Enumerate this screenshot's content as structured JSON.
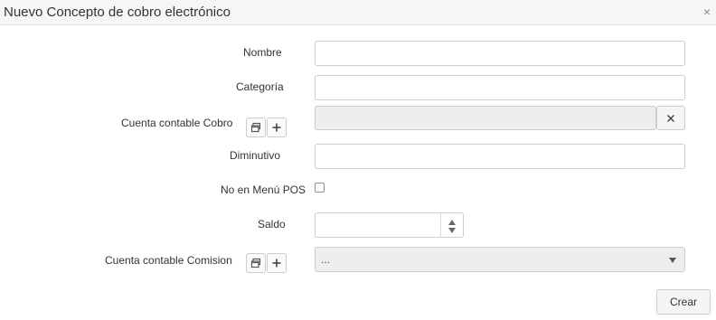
{
  "dialog": {
    "title": "Nuevo Concepto de cobro electrónico",
    "close_glyph": "×"
  },
  "fields": {
    "nombre": {
      "label": "Nombre",
      "value": ""
    },
    "categoria": {
      "label": "Categoría",
      "value": ""
    },
    "cuenta_cobro": {
      "label": "Cuenta contable Cobro",
      "value": ""
    },
    "diminutivo": {
      "label": "Diminutivo",
      "value": ""
    },
    "no_en_menu_pos": {
      "label": "No en Menú POS",
      "checked": false
    },
    "saldo": {
      "label": "Saldo",
      "value": ""
    },
    "cuenta_comision": {
      "label": "Cuenta contable Comision",
      "selected": "..."
    }
  },
  "buttons": {
    "create": "Crear"
  },
  "icons": {
    "browse": "window-restore-icon",
    "add": "plus-icon",
    "clear": "times-icon",
    "spin_up": "caret-up-icon",
    "spin_down": "caret-down-icon",
    "select": "caret-down-icon"
  },
  "colors": {
    "titlebar_bg": "#f6f6f6",
    "border": "#cccccc",
    "disabled_bg": "#eeeeee",
    "text": "#333333"
  }
}
